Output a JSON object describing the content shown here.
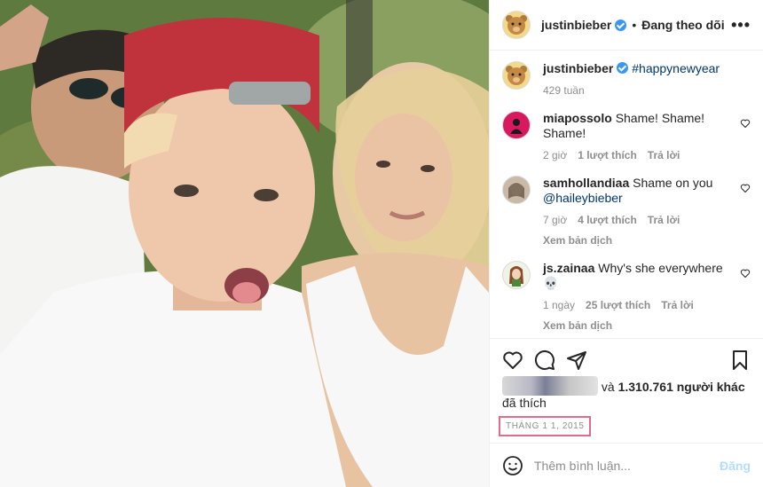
{
  "post": {
    "author": "justinbieber",
    "follow_status": "Đang theo dõi",
    "caption_tag": "#happynewyear",
    "caption_age": "429 tuần"
  },
  "comments": [
    {
      "user": "miapossolo",
      "text": "Shame! Shame! Shame!",
      "age": "2 giờ",
      "likes": "1 lượt thích",
      "reply": "Trả lời",
      "translate": ""
    },
    {
      "user": "samhollandiaa",
      "text": "Shame on you",
      "mention": "@haileybieber",
      "age": "7 giờ",
      "likes": "4 lượt thích",
      "reply": "Trả lời",
      "translate": "Xem bản dịch"
    },
    {
      "user": "js.zainaa",
      "text": "Why's she everywhere 💀",
      "age": "1 ngày",
      "likes": "25 lượt thích",
      "reply": "Trả lời",
      "translate": "Xem bản dịch"
    }
  ],
  "likes_text": "và 1.310.761 người khác đã thích",
  "likes_prefix": "và",
  "likes_count": "1.310.761 người khác",
  "likes_suffix": "đã thích",
  "date": "THÁNG 1 1, 2015",
  "add_comment": {
    "placeholder": "Thêm bình luận...",
    "post_label": "Đăng"
  },
  "colors": {
    "verified": "#3897f0",
    "link": "#00376b",
    "date_highlight": "#e06b8a",
    "post_button": "#b2dffc"
  },
  "icons": [
    "heart-icon",
    "comment-icon",
    "share-icon",
    "bookmark-icon",
    "emoji-icon",
    "more-icon",
    "verified-icon"
  ]
}
